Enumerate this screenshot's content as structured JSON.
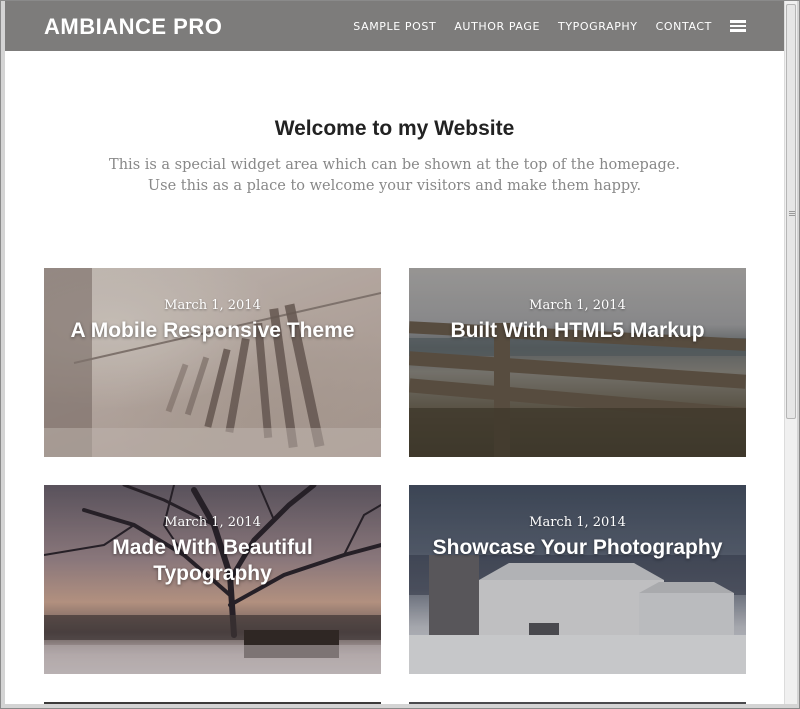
{
  "site": {
    "title": "AMBIANCE PRO",
    "nav": [
      "SAMPLE POST",
      "AUTHOR PAGE",
      "TYPOGRAPHY",
      "CONTACT"
    ],
    "menu_icon": "hamburger-icon"
  },
  "welcome": {
    "title": "Welcome to my Website",
    "line1": "This is a special widget area which can be shown at the top of the homepage.",
    "line2": "Use this as a place to welcome your visitors and make them happy."
  },
  "posts": [
    {
      "date": "March 1, 2014",
      "title": "A Mobile Responsive Theme",
      "image": "clothespins-photo"
    },
    {
      "date": "March 1, 2014",
      "title": "Built With HTML5 Markup",
      "image": "fence-photo"
    },
    {
      "date": "March 1, 2014",
      "title": "Made With Beautiful Typography",
      "image": "winter-tree-photo"
    },
    {
      "date": "March 1, 2014",
      "title": "Showcase Your Photography",
      "image": "barn-photo"
    }
  ],
  "colors": {
    "header_bg": "#7d7c7b",
    "header_text": "#ffffff",
    "welcome_title": "#222222",
    "welcome_text": "#888888"
  }
}
